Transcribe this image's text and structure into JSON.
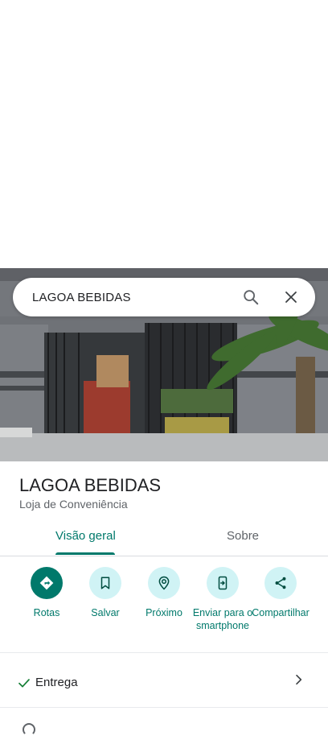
{
  "search": {
    "query": "LAGOA BEBIDAS"
  },
  "place": {
    "name": "LAGOA BEBIDAS",
    "category": "Loja de Conveniência"
  },
  "tabs": [
    {
      "label": "Visão geral",
      "active": true
    },
    {
      "label": "Sobre",
      "active": false
    }
  ],
  "actions": [
    {
      "label": "Rotas",
      "icon": "directions-icon"
    },
    {
      "label": "Salvar",
      "icon": "bookmark-icon"
    },
    {
      "label": "Próximo",
      "icon": "nearby-icon"
    },
    {
      "label": "Enviar para o smartphone",
      "icon": "send-to-phone-icon"
    },
    {
      "label": "Compartilhar",
      "icon": "share-icon"
    }
  ],
  "attributes": [
    {
      "label": "Entrega",
      "available": true
    }
  ],
  "colors": {
    "accent": "#00796b",
    "chip": "#d0f3f5"
  }
}
